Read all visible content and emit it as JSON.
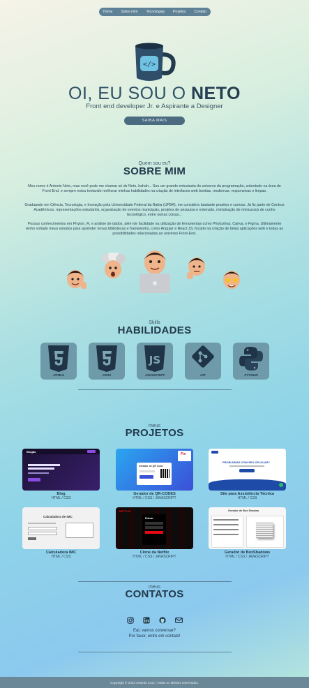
{
  "nav": {
    "items": [
      "Home",
      "Sobre mim",
      "Tecnologias",
      "Projetos",
      "Contato"
    ]
  },
  "hero": {
    "title_prefix": "OI, EU SOU O ",
    "title_name": "NETO",
    "subtitle": "Front end developer Jr. e Aspirante a Designer",
    "button": "SAIBA MAIS"
  },
  "about": {
    "kicker": "Quem sou eu?",
    "title": "SOBRE MIM",
    "p1": "Meu nome é Antonio Neto, mas você pode me chamar só de Neto, hahah... Sou um grande entusiasta do universo da programação, sobretudo na área de Front-End, e sempre estou tentando melhorar minhas habilidades na criação de interfaces web bonitas, modernas, responsivas e limpas.",
    "p2": "Graduando em Ciência, Tecnologia, e Inovação pela Universidade Federal da Bahia (UFBA), me considero bastante proativo e curioso. Já fiz parte de Centros Acadêmicos, representações estudantis, organização de eventos municipais, projetos de pesquisa e extensão, ministração de minicursos de cunho tecnológico, entre outras coisas...",
    "p3": "Possuo conhecimentos em Phyton, R, e análise de dados, além de facilidade na utilização de ferramentas como Photoshop, Canva, e Figma. Ultimamente tenho voltado meus estudos para aprender novas bibliotecas e frameworks, como Angular e React JS, focado na criação de belas aplicações web e todas as possibilidades relacionadas ao universo Front-End."
  },
  "skills": {
    "kicker": "Skills",
    "title": "HABILIDADES",
    "items": [
      {
        "label": "HTML5",
        "icon": "html5-icon"
      },
      {
        "label": "CSS3",
        "icon": "css3-icon"
      },
      {
        "label": "JAVASCRIPT",
        "icon": "javascript-icon"
      },
      {
        "label": "GIT",
        "icon": "git-icon"
      },
      {
        "label": "PYTHON",
        "icon": "python-icon"
      }
    ]
  },
  "projects": {
    "kicker": "meus",
    "title": "PROJETOS",
    "items": [
      {
        "title": "Blog",
        "stack": "HTML / CSS",
        "thumb_label": "Blogão"
      },
      {
        "title": "Gerador de QR-CODES",
        "stack": "HTML / CSS / JAVASCRIPT",
        "thumb_label": "Gerador de QR Code"
      },
      {
        "title": "Site para Assistência Técnica",
        "stack": "HTML / CSS",
        "thumb_label": "PROBLEMAS COM SEU CELULAR?"
      },
      {
        "title": "Calculadora IMC",
        "stack": "HTML / CSS",
        "thumb_label": "Calculadora de IMC"
      },
      {
        "title": "Clone da Netflix",
        "stack": "HTML / CSS / JAVASCRIPT",
        "thumb_label": "Entrar"
      },
      {
        "title": "Gerador de BoxShadows",
        "stack": "HTML / CSS / JAVASCRIPT",
        "thumb_label": "Gerador de Box Shadow"
      }
    ]
  },
  "contacts": {
    "kicker": "meus",
    "title": "CONTATOS",
    "icons": [
      "instagram-icon",
      "linkedin-icon",
      "github-icon",
      "email-icon"
    ],
    "line1": "Eai, vamos conversar?",
    "line2": "Por favor, entre em contato!"
  },
  "footer": {
    "text": "Copyright © 2023 Antonio Cruz | Todos os direitos reservados."
  }
}
